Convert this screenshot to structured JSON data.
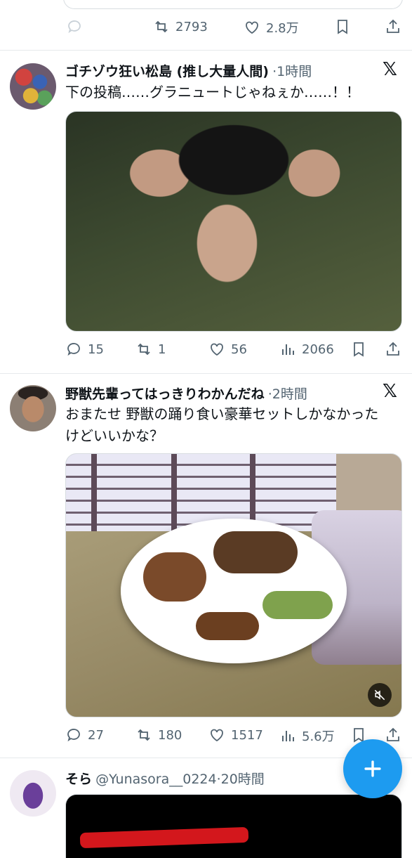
{
  "top_bar": {
    "retweets": "2793",
    "likes": "2.8万"
  },
  "posts": [
    {
      "name": "ゴチゾウ狂い松島 (推し大量人間)",
      "time": "·1時間",
      "text": "下の投稿……グラニュートじゃねぇか……！！",
      "replies": "15",
      "retweets": "1",
      "likes": "56",
      "views": "2066"
    },
    {
      "name": "野獣先輩ってはっきりわかんだね",
      "time": "·2時間",
      "text_line1": "おまたせ 野獣の踊り食い豪華セットしかなかった",
      "text_line2": "けどいいかな？",
      "replies": "27",
      "retweets": "180",
      "likes": "1517",
      "views": "5.6万"
    },
    {
      "name": "そら",
      "handle": "@Yunasora__0224",
      "time": "·20時間"
    }
  ],
  "icons": {
    "reply": "reply-icon",
    "retweet": "retweet-icon",
    "like": "heart-icon",
    "views": "views-icon",
    "bookmark": "bookmark-icon",
    "share": "share-icon",
    "mute": "mute-icon",
    "compose": "plus-icon",
    "x_logo": "x-logo-icon"
  },
  "colors": {
    "accent": "#1d9bf0",
    "secondary_text": "#536471"
  }
}
